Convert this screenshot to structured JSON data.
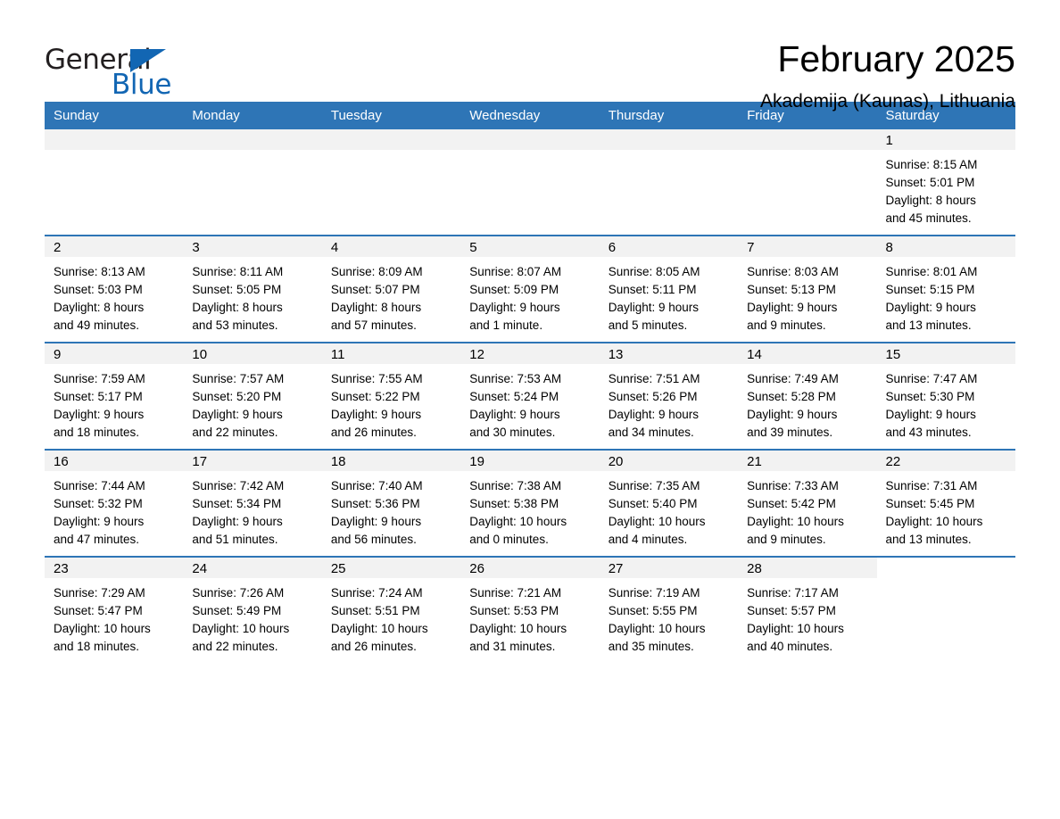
{
  "brand": {
    "word_one": "General",
    "word_two": "Blue",
    "accent_color": "#1266b3",
    "triangle_icon": "triangle-icon"
  },
  "header": {
    "title": "February 2025",
    "subtitle": "Akademija (Kaunas), Lithuania"
  },
  "calendar": {
    "header_bg": "#2e75b6",
    "daynum_bg": "#f2f2f2",
    "weekdays": [
      "Sunday",
      "Monday",
      "Tuesday",
      "Wednesday",
      "Thursday",
      "Friday",
      "Saturday"
    ],
    "weeks": [
      [
        {
          "day": "",
          "blank": true
        },
        {
          "day": "",
          "blank": true
        },
        {
          "day": "",
          "blank": true
        },
        {
          "day": "",
          "blank": true
        },
        {
          "day": "",
          "blank": true
        },
        {
          "day": "",
          "blank": true
        },
        {
          "day": "1",
          "sunrise": "Sunrise: 8:15 AM",
          "sunset": "Sunset: 5:01 PM",
          "daylight_1": "Daylight: 8 hours",
          "daylight_2": "and 45 minutes."
        }
      ],
      [
        {
          "day": "2",
          "sunrise": "Sunrise: 8:13 AM",
          "sunset": "Sunset: 5:03 PM",
          "daylight_1": "Daylight: 8 hours",
          "daylight_2": "and 49 minutes."
        },
        {
          "day": "3",
          "sunrise": "Sunrise: 8:11 AM",
          "sunset": "Sunset: 5:05 PM",
          "daylight_1": "Daylight: 8 hours",
          "daylight_2": "and 53 minutes."
        },
        {
          "day": "4",
          "sunrise": "Sunrise: 8:09 AM",
          "sunset": "Sunset: 5:07 PM",
          "daylight_1": "Daylight: 8 hours",
          "daylight_2": "and 57 minutes."
        },
        {
          "day": "5",
          "sunrise": "Sunrise: 8:07 AM",
          "sunset": "Sunset: 5:09 PM",
          "daylight_1": "Daylight: 9 hours",
          "daylight_2": "and 1 minute."
        },
        {
          "day": "6",
          "sunrise": "Sunrise: 8:05 AM",
          "sunset": "Sunset: 5:11 PM",
          "daylight_1": "Daylight: 9 hours",
          "daylight_2": "and 5 minutes."
        },
        {
          "day": "7",
          "sunrise": "Sunrise: 8:03 AM",
          "sunset": "Sunset: 5:13 PM",
          "daylight_1": "Daylight: 9 hours",
          "daylight_2": "and 9 minutes."
        },
        {
          "day": "8",
          "sunrise": "Sunrise: 8:01 AM",
          "sunset": "Sunset: 5:15 PM",
          "daylight_1": "Daylight: 9 hours",
          "daylight_2": "and 13 minutes."
        }
      ],
      [
        {
          "day": "9",
          "sunrise": "Sunrise: 7:59 AM",
          "sunset": "Sunset: 5:17 PM",
          "daylight_1": "Daylight: 9 hours",
          "daylight_2": "and 18 minutes."
        },
        {
          "day": "10",
          "sunrise": "Sunrise: 7:57 AM",
          "sunset": "Sunset: 5:20 PM",
          "daylight_1": "Daylight: 9 hours",
          "daylight_2": "and 22 minutes."
        },
        {
          "day": "11",
          "sunrise": "Sunrise: 7:55 AM",
          "sunset": "Sunset: 5:22 PM",
          "daylight_1": "Daylight: 9 hours",
          "daylight_2": "and 26 minutes."
        },
        {
          "day": "12",
          "sunrise": "Sunrise: 7:53 AM",
          "sunset": "Sunset: 5:24 PM",
          "daylight_1": "Daylight: 9 hours",
          "daylight_2": "and 30 minutes."
        },
        {
          "day": "13",
          "sunrise": "Sunrise: 7:51 AM",
          "sunset": "Sunset: 5:26 PM",
          "daylight_1": "Daylight: 9 hours",
          "daylight_2": "and 34 minutes."
        },
        {
          "day": "14",
          "sunrise": "Sunrise: 7:49 AM",
          "sunset": "Sunset: 5:28 PM",
          "daylight_1": "Daylight: 9 hours",
          "daylight_2": "and 39 minutes."
        },
        {
          "day": "15",
          "sunrise": "Sunrise: 7:47 AM",
          "sunset": "Sunset: 5:30 PM",
          "daylight_1": "Daylight: 9 hours",
          "daylight_2": "and 43 minutes."
        }
      ],
      [
        {
          "day": "16",
          "sunrise": "Sunrise: 7:44 AM",
          "sunset": "Sunset: 5:32 PM",
          "daylight_1": "Daylight: 9 hours",
          "daylight_2": "and 47 minutes."
        },
        {
          "day": "17",
          "sunrise": "Sunrise: 7:42 AM",
          "sunset": "Sunset: 5:34 PM",
          "daylight_1": "Daylight: 9 hours",
          "daylight_2": "and 51 minutes."
        },
        {
          "day": "18",
          "sunrise": "Sunrise: 7:40 AM",
          "sunset": "Sunset: 5:36 PM",
          "daylight_1": "Daylight: 9 hours",
          "daylight_2": "and 56 minutes."
        },
        {
          "day": "19",
          "sunrise": "Sunrise: 7:38 AM",
          "sunset": "Sunset: 5:38 PM",
          "daylight_1": "Daylight: 10 hours",
          "daylight_2": "and 0 minutes."
        },
        {
          "day": "20",
          "sunrise": "Sunrise: 7:35 AM",
          "sunset": "Sunset: 5:40 PM",
          "daylight_1": "Daylight: 10 hours",
          "daylight_2": "and 4 minutes."
        },
        {
          "day": "21",
          "sunrise": "Sunrise: 7:33 AM",
          "sunset": "Sunset: 5:42 PM",
          "daylight_1": "Daylight: 10 hours",
          "daylight_2": "and 9 minutes."
        },
        {
          "day": "22",
          "sunrise": "Sunrise: 7:31 AM",
          "sunset": "Sunset: 5:45 PM",
          "daylight_1": "Daylight: 10 hours",
          "daylight_2": "and 13 minutes."
        }
      ],
      [
        {
          "day": "23",
          "sunrise": "Sunrise: 7:29 AM",
          "sunset": "Sunset: 5:47 PM",
          "daylight_1": "Daylight: 10 hours",
          "daylight_2": "and 18 minutes."
        },
        {
          "day": "24",
          "sunrise": "Sunrise: 7:26 AM",
          "sunset": "Sunset: 5:49 PM",
          "daylight_1": "Daylight: 10 hours",
          "daylight_2": "and 22 minutes."
        },
        {
          "day": "25",
          "sunrise": "Sunrise: 7:24 AM",
          "sunset": "Sunset: 5:51 PM",
          "daylight_1": "Daylight: 10 hours",
          "daylight_2": "and 26 minutes."
        },
        {
          "day": "26",
          "sunrise": "Sunrise: 7:21 AM",
          "sunset": "Sunset: 5:53 PM",
          "daylight_1": "Daylight: 10 hours",
          "daylight_2": "and 31 minutes."
        },
        {
          "day": "27",
          "sunrise": "Sunrise: 7:19 AM",
          "sunset": "Sunset: 5:55 PM",
          "daylight_1": "Daylight: 10 hours",
          "daylight_2": "and 35 minutes."
        },
        {
          "day": "28",
          "sunrise": "Sunrise: 7:17 AM",
          "sunset": "Sunset: 5:57 PM",
          "daylight_1": "Daylight: 10 hours",
          "daylight_2": "and 40 minutes."
        },
        {
          "day": "",
          "blank": true
        }
      ]
    ]
  }
}
